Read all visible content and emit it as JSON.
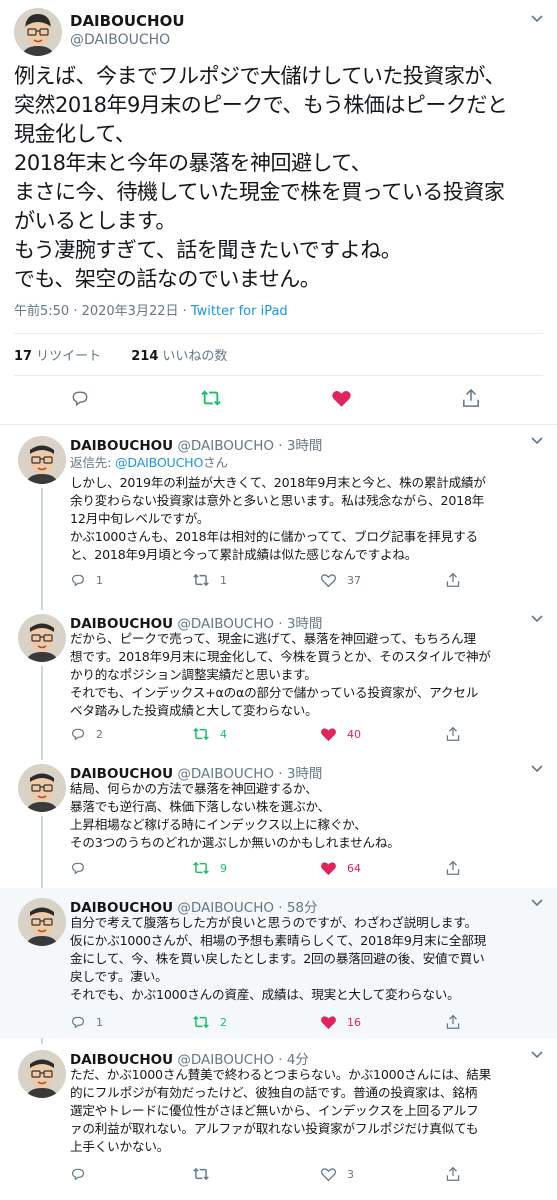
{
  "main": {
    "name": "DAIBOUCHOU",
    "handle": "@DAIBOUCHO",
    "text": "例えば、今までフルポジで大儲けしていた投資家が、\n突然2018年9月末のピークで、もう株価はピークだと\n現金化して、\n2018年末と今年の暴落を神回避して、\nまさに今、待機していた現金で株を買っている投資家\nがいるとします。\nもう凄腕すぎて、話を聞きたいですよね。\nでも、架空の話なのでいません。",
    "timestamp": "午前5:50 · 2020年3月22日 · ",
    "via": "Twitter for iPad",
    "retweets_count": "17",
    "retweets_label": "リツイート",
    "likes_count": "214",
    "likes_label": "いいねの数"
  },
  "replies": [
    {
      "name": "DAIBOUCHOU",
      "handle": "@DAIBOUCHO",
      "time": "· 3時間",
      "reply_prefix": "返信先: ",
      "reply_to": "@DAIBOUCHO",
      "reply_suffix": "さん",
      "text": "しかし、2019年の利益が大きくて、2018年9月末と今と、株の累計成績が\n余り変わらない投資家は意外と多いと思います。私は残念ながら、2018年\n12月中旬レベルですが。\nかぶ1000さんも、2018年は相対的に儲かってて、ブログ記事を拝見する\nと、2018年9月頃と今って累計成績は似た感じなんですよね。",
      "replies": "1",
      "retweets": "1",
      "likes": "37"
    },
    {
      "name": "DAIBOUCHOU",
      "handle": "@DAIBOUCHO",
      "time": "· 3時間",
      "text": "だから、ピークで売って、現金に逃げて、暴落を神回避って、もちろん理\n想です。2018年9月末に現金化して、今株を買うとか、そのスタイルで神が\nかり的なポジション調整実績だと思います。\nそれでも、インデックス+αのαの部分で儲かっている投資家が、アクセル\nベタ踏みした投資成績と大して変わらない。",
      "replies": "2",
      "retweets": "4",
      "likes": "40"
    },
    {
      "name": "DAIBOUCHOU",
      "handle": "@DAIBOUCHO",
      "time": "· 3時間",
      "text": "結局、何らかの方法で暴落を神回避するか、\n暴落でも逆行高、株価下落しない株を選ぶか、\n上昇相場など稼げる時にインデックス以上に稼ぐか、\nその3つのうちのどれか選ぶしか無いのかもしれませんね。",
      "replies": "",
      "retweets": "9",
      "likes": "64"
    },
    {
      "name": "DAIBOUCHOU",
      "handle": "@DAIBOUCHO",
      "time": "· 58分",
      "text": "自分で考えて腹落ちした方が良いと思うのですが、わざわざ説明します。\n仮にかぶ1000さんが、相場の予想も素晴らしくて、2018年9月末に全部現\n金にして、今、株を買い戻したとします。2回の暴落回避の後、安値で買い\n戻しです。凄い。\nそれでも、かぶ1000さんの資産、成績は、現実と大して変わらない。",
      "replies": "1",
      "retweets": "2",
      "likes": "16"
    },
    {
      "name": "DAIBOUCHOU",
      "handle": "@DAIBOUCHO",
      "time": "· 4分",
      "text": "ただ、かぶ1000さん賛美で終わるとつまらない。かぶ1000さんには、結果\n的にフルポジが有効だったけど、彼独自の話です。普通の投資家は、銘柄\n選定やトレードに優位性がさほど無いから、インデックスを上回るアルフ\nァの利益が取れない。アルファが取れない投資家がフルポジだけ真似ても\n上手くいかない。",
      "replies": "",
      "retweets": "",
      "likes": "3"
    }
  ],
  "colors": {
    "accent": "#1b95e0",
    "retweet_active": "#17bf63",
    "like_active": "#e0245e",
    "muted": "#657786"
  }
}
